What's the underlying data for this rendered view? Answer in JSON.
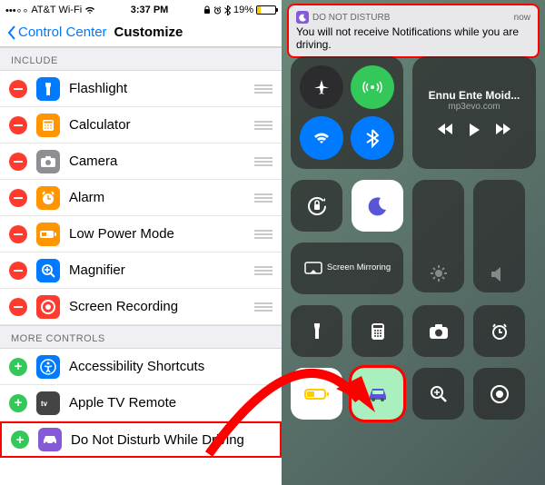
{
  "status_bar": {
    "carrier": "AT&T Wi-Fi",
    "time": "3:37 PM",
    "battery_percent": "19%"
  },
  "nav": {
    "back": "Control Center",
    "title": "Customize"
  },
  "sections": {
    "include": "INCLUDE",
    "more": "MORE CONTROLS"
  },
  "include_items": [
    {
      "label": "Flashlight",
      "icon": "flashlight",
      "color": "#007aff"
    },
    {
      "label": "Calculator",
      "icon": "calculator",
      "color": "#ff9500"
    },
    {
      "label": "Camera",
      "icon": "camera",
      "color": "#8e8e93"
    },
    {
      "label": "Alarm",
      "icon": "alarm",
      "color": "#ff9500"
    },
    {
      "label": "Low Power Mode",
      "icon": "battery",
      "color": "#ff9500"
    },
    {
      "label": "Magnifier",
      "icon": "magnifier",
      "color": "#007aff"
    },
    {
      "label": "Screen Recording",
      "icon": "record",
      "color": "#ff3b30"
    }
  ],
  "more_items": [
    {
      "label": "Accessibility Shortcuts",
      "icon": "accessibility",
      "color": "#007aff"
    },
    {
      "label": "Apple TV Remote",
      "icon": "apple-tv",
      "color": "#444"
    },
    {
      "label": "Do Not Disturb While Driving",
      "icon": "car",
      "color": "#845ad6"
    }
  ],
  "notification": {
    "app": "DO NOT DISTURB",
    "time": "now",
    "body": "You will not receive Notifications while you are driving."
  },
  "music": {
    "title": "Ennu Ente Moid...",
    "subtitle": "mp3evo.com"
  },
  "mirror_label": "Screen Mirroring"
}
